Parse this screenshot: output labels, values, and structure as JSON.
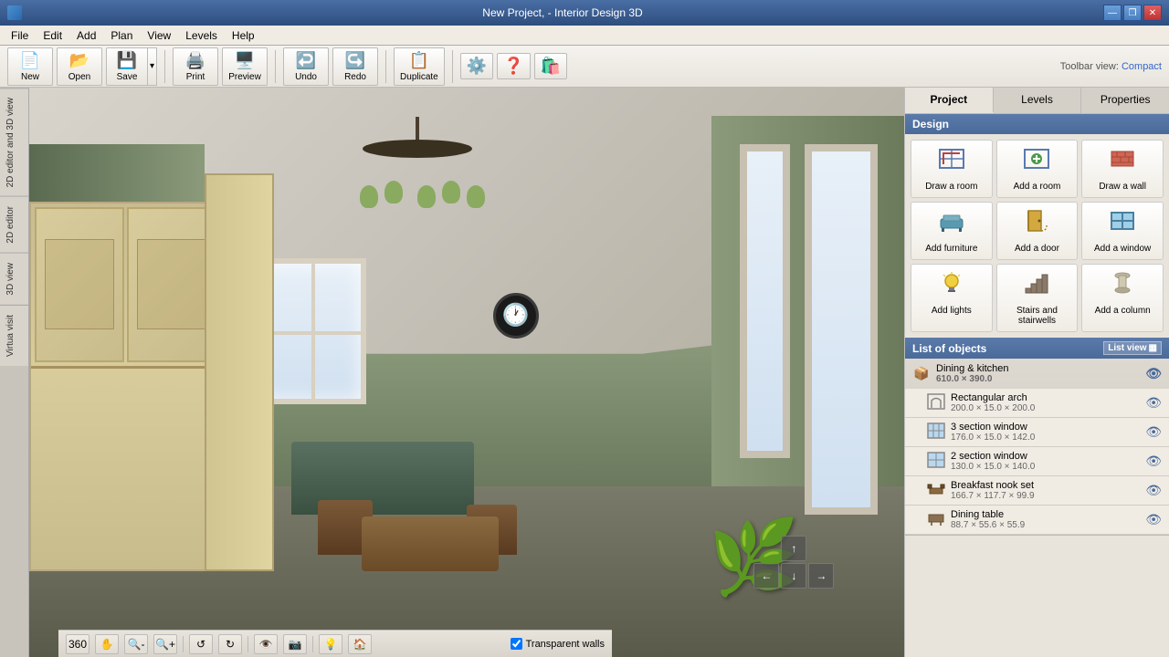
{
  "window": {
    "title": "New Project, - Interior Design 3D",
    "toolbar_view_label": "Toolbar view:",
    "compact_label": "Compact"
  },
  "titlebar": {
    "min": "—",
    "restore": "❒",
    "close": "✕"
  },
  "menu": {
    "items": [
      "File",
      "Edit",
      "Add",
      "Plan",
      "View",
      "Levels",
      "Help"
    ]
  },
  "toolbar": {
    "new_label": "New",
    "open_label": "Open",
    "save_label": "Save",
    "print_label": "Print",
    "preview_label": "Preview",
    "undo_label": "Undo",
    "redo_label": "Redo",
    "duplicate_label": "Duplicate"
  },
  "left_tabs": [
    "2D editor and 3D view",
    "2D editor",
    "3D view",
    "Virtua visit"
  ],
  "right_panel": {
    "tabs": [
      "Project",
      "Levels",
      "Properties"
    ],
    "active_tab": "Project",
    "design_section": "Design",
    "design_items": [
      {
        "icon": "🏠",
        "label": "Draw a room"
      },
      {
        "icon": "🏠",
        "label": "Add a room"
      },
      {
        "icon": "🧱",
        "label": "Draw a wall"
      },
      {
        "icon": "🪑",
        "label": "Add furniture"
      },
      {
        "icon": "🚪",
        "label": "Add a door"
      },
      {
        "icon": "🪟",
        "label": "Add a window"
      },
      {
        "icon": "💡",
        "label": "Add lights"
      },
      {
        "icon": "🪜",
        "label": "Stairs and stairwells"
      },
      {
        "icon": "🏛️",
        "label": "Add a column"
      }
    ],
    "objects_header": "List of objects",
    "list_view_label": "List view",
    "objects": [
      {
        "group": "Dining & kitchen",
        "dims": "610.0 × 390.0",
        "icon": "📦",
        "items": [
          {
            "name": "Rectangular arch",
            "dims": "200.0 × 15.0 × 200.0",
            "icon": "🔲"
          },
          {
            "name": "3 section window",
            "dims": "176.0 × 15.0 × 142.0",
            "icon": "🪟"
          },
          {
            "name": "2 section window",
            "dims": "130.0 × 15.0 × 140.0",
            "icon": "🪟"
          },
          {
            "name": "Breakfast nook set",
            "dims": "166.7 × 117.7 × 99.9",
            "icon": "🪑"
          },
          {
            "name": "Dining table",
            "dims": "88.7 × 55.6 × 55.9",
            "icon": "🪑"
          }
        ]
      }
    ]
  },
  "bottom_toolbar": {
    "transparent_walls_label": "Transparent walls"
  },
  "viewport": {
    "nav_arrows": [
      "↑",
      "←",
      "→",
      "↙",
      "↓",
      "↘"
    ]
  }
}
